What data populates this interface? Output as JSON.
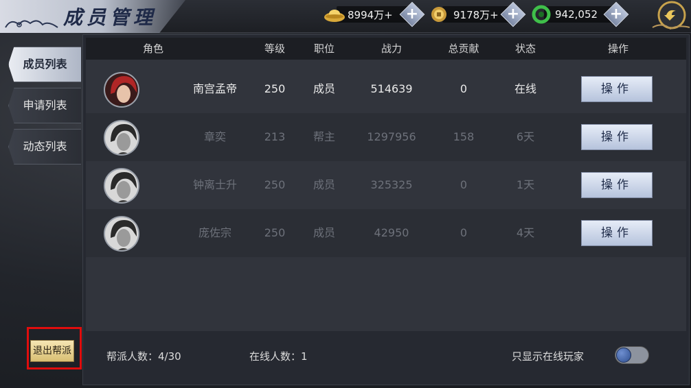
{
  "header": {
    "title": "成员管理",
    "resources": [
      {
        "icon": "gold-ingot-icon",
        "value": "8994万+"
      },
      {
        "icon": "coin-icon",
        "value": "9178万+"
      },
      {
        "icon": "jade-ring-icon",
        "value": "942,052"
      }
    ],
    "plus_label": "+"
  },
  "sidebar": {
    "tabs": [
      {
        "label": "成员列表",
        "active": true
      },
      {
        "label": "申请列表",
        "active": false
      },
      {
        "label": "动态列表",
        "active": false
      }
    ],
    "quit_label": "退出帮派"
  },
  "table": {
    "columns": [
      "角色",
      "等级",
      "职位",
      "战力",
      "总贡献",
      "状态",
      "操作"
    ],
    "rows": [
      {
        "name": "南宫孟帝",
        "level": "250",
        "position": "成员",
        "power": "514639",
        "contribution": "0",
        "status": "在线",
        "action": "操作",
        "online": true
      },
      {
        "name": "章奕",
        "level": "213",
        "position": "帮主",
        "power": "1297956",
        "contribution": "158",
        "status": "6天",
        "action": "操作",
        "online": false
      },
      {
        "name": "钟离士升",
        "level": "250",
        "position": "成员",
        "power": "325325",
        "contribution": "0",
        "status": "1天",
        "action": "操作",
        "online": false
      },
      {
        "name": "庞佐宗",
        "level": "250",
        "position": "成员",
        "power": "42950",
        "contribution": "0",
        "status": "4天",
        "action": "操作",
        "online": false
      }
    ]
  },
  "footer": {
    "member_count": "帮派人数：4/30",
    "online_count": "在线人数：1",
    "online_only_label": "只显示在线玩家",
    "online_only_enabled": false
  },
  "colors": {
    "accent": "#b6c3dc",
    "highlight_border": "#e00d0d",
    "online_text": "#eaeaea",
    "offline_text": "#6d717a"
  }
}
